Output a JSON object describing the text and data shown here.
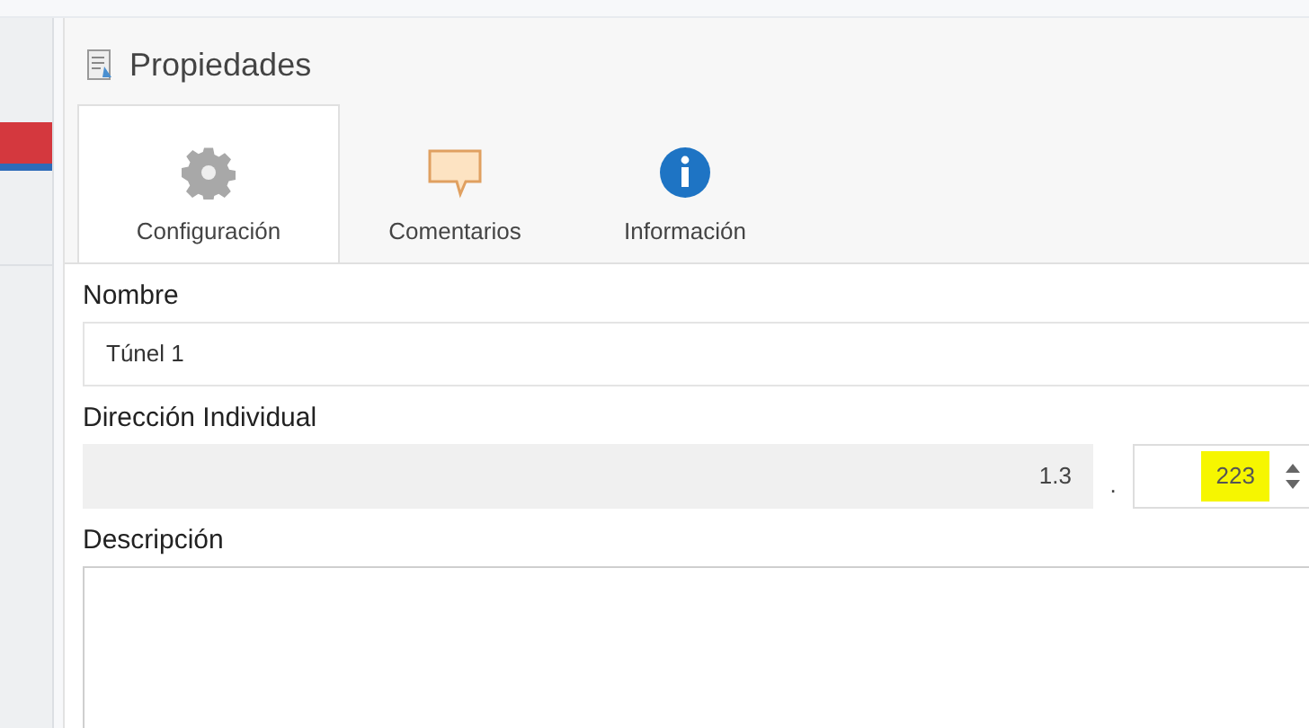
{
  "panel": {
    "title": "Propiedades"
  },
  "tabs": [
    {
      "label": "Configuración",
      "kind": "gear",
      "selected": true
    },
    {
      "label": "Comentarios",
      "kind": "comment",
      "selected": false
    },
    {
      "label": "Información",
      "kind": "info",
      "selected": false
    }
  ],
  "fields": [
    {
      "kind": "text",
      "label": "Nombre",
      "value": "Túnel 1"
    },
    {
      "kind": "address",
      "label": "Dirección Individual",
      "prefix": "1.3",
      "separator": ".",
      "value": "223",
      "highlighted": true
    },
    {
      "kind": "textarea",
      "label": "Descripción"
    }
  ]
}
